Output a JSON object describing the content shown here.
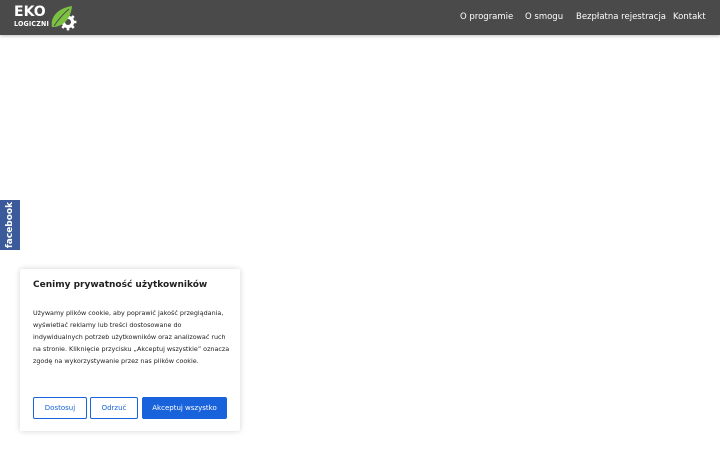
{
  "header": {
    "logo": {
      "title": "EKO",
      "subtitle": "LOGICZNI",
      "mark_icon": "leaf-gear-icon",
      "colors": {
        "leaf": "#7cc242",
        "gear": "#ffffff"
      }
    },
    "nav": {
      "items": [
        {
          "label": "O programie"
        },
        {
          "label": "O smogu"
        },
        {
          "label": "Bezpłatna rejestracja"
        },
        {
          "label": "Kontakt"
        }
      ]
    },
    "background_color": "#4a4a4a"
  },
  "side_tab": {
    "label": "facebook",
    "color": "#3b5a9a"
  },
  "cookie_banner": {
    "title": "Cenimy prywatność użytkowników",
    "body": "Używamy plików cookie, aby poprawić jakość przeglądania, wyświetlać reklamy lub treści dostosowane do indywidualnych potrzeb użytkowników oraz analizować ruch na stronie. Kliknięcie przycisku „Akceptuj wszystkie” oznacza zgodę na wykorzystywanie przez nas plików cookie.",
    "buttons": {
      "customize": "Dostosuj",
      "reject": "Odrzuć",
      "accept": "Akceptuj wszystko"
    },
    "accent_color": "#1863dc"
  }
}
